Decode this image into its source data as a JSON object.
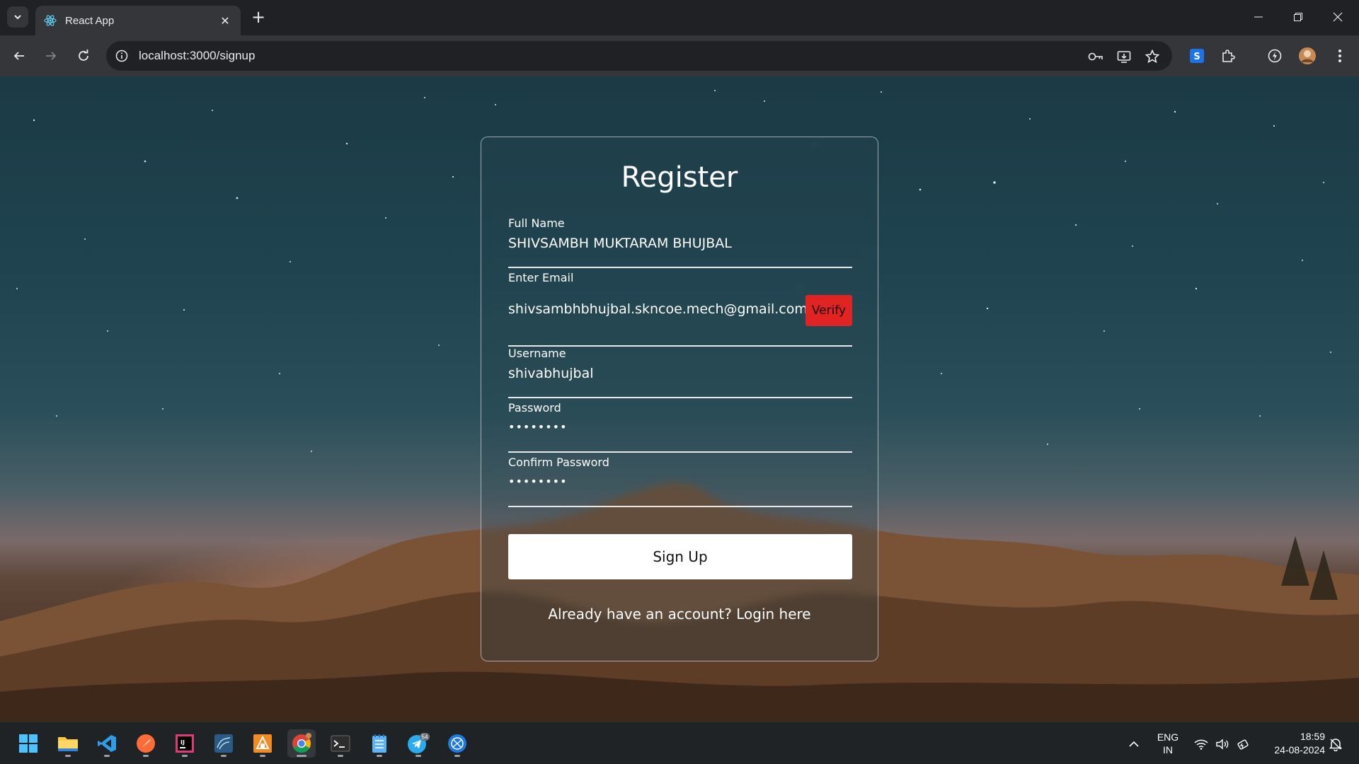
{
  "browser": {
    "tab": {
      "title": "React App",
      "icon": "react-icon"
    },
    "url": "localhost:3000/signup",
    "icons": [
      "back-icon",
      "forward-icon",
      "reload-icon",
      "site-info-icon",
      "password-key-icon",
      "install-app-icon",
      "bookmark-star-icon",
      "extension-s-icon",
      "extensions-puzzle-icon",
      "performance-icon",
      "profile-avatar",
      "menu-kebab-icon"
    ]
  },
  "form": {
    "title": "Register",
    "fields": {
      "full_name": {
        "label": "Full Name",
        "value": "SHIVSAMBH MUKTARAM BHUJBAL"
      },
      "email": {
        "label": "Enter Email",
        "value": "shivsambhbhujbal.skncoe.mech@gmail.com",
        "verify_label": "Verify"
      },
      "username": {
        "label": "Username",
        "value": "shivabhujbal"
      },
      "password": {
        "label": "Password",
        "value": "••••••••"
      },
      "confirm_password": {
        "label": "Confirm Password",
        "value": "••••••••"
      }
    },
    "submit_label": "Sign Up",
    "login_text": "Already have an account? Login here",
    "verify_color": "#e02424"
  },
  "taskbar": {
    "apps": [
      "windows-start-icon",
      "file-explorer-icon",
      "vscode-icon",
      "postman-icon",
      "intellij-icon",
      "mysql-workbench-icon",
      "git-app-icon",
      "chrome-icon",
      "terminal-icon",
      "notepad-icon",
      "telegram-icon",
      "network-app-icon"
    ],
    "telegram_badge": "54",
    "language": {
      "line1": "ENG",
      "line2": "IN"
    },
    "time": "18:59",
    "date": "24-08-2024"
  }
}
